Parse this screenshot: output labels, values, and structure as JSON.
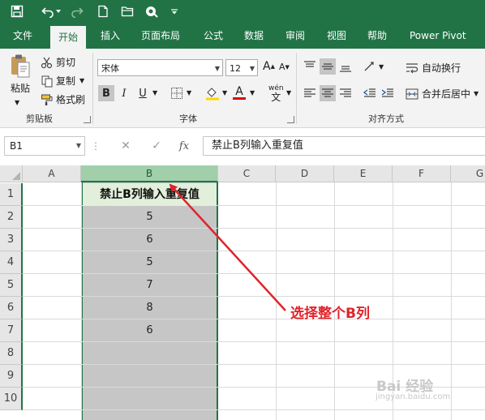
{
  "ribbon_tabs": [
    {
      "label": "文件"
    },
    {
      "label": "开始"
    },
    {
      "label": "插入"
    },
    {
      "label": "页面布局"
    },
    {
      "label": "公式"
    },
    {
      "label": "数据"
    },
    {
      "label": "审阅"
    },
    {
      "label": "视图"
    },
    {
      "label": "帮助"
    },
    {
      "label": "Power Pivot"
    }
  ],
  "clipboard": {
    "paste": "粘贴",
    "cut": "剪切",
    "copy": "复制",
    "format_painter": "格式刷",
    "group_label": "剪贴板"
  },
  "font": {
    "name": "宋体",
    "size": "12",
    "bold": "B",
    "italic": "I",
    "underline": "U",
    "phonetic": "wén",
    "font_color": "A",
    "group_label": "字体"
  },
  "alignment": {
    "wrap_text": "自动换行",
    "merge_center": "合并后居中",
    "group_label": "对齐方式"
  },
  "formula_bar": {
    "name_box": "B1",
    "fx": "fx",
    "formula": "禁止B列输入重复值"
  },
  "sheet": {
    "columns": [
      "A",
      "B",
      "C",
      "D",
      "E",
      "F",
      "G"
    ],
    "rows": [
      "1",
      "2",
      "3",
      "4",
      "5",
      "6",
      "7",
      "8",
      "9",
      "10"
    ],
    "b_values": [
      "禁止B列输入重复值",
      "5",
      "6",
      "5",
      "7",
      "8",
      "6"
    ]
  },
  "annotation": "选择整个B列",
  "watermark": {
    "main": "Bai 经验",
    "sub": "jingyan.baidu.com"
  },
  "colors": {
    "excel_green": "#217346",
    "selection_fill": "#c6c6c6",
    "header_fill": "#e2efda",
    "annotation_red": "#e0242b"
  }
}
